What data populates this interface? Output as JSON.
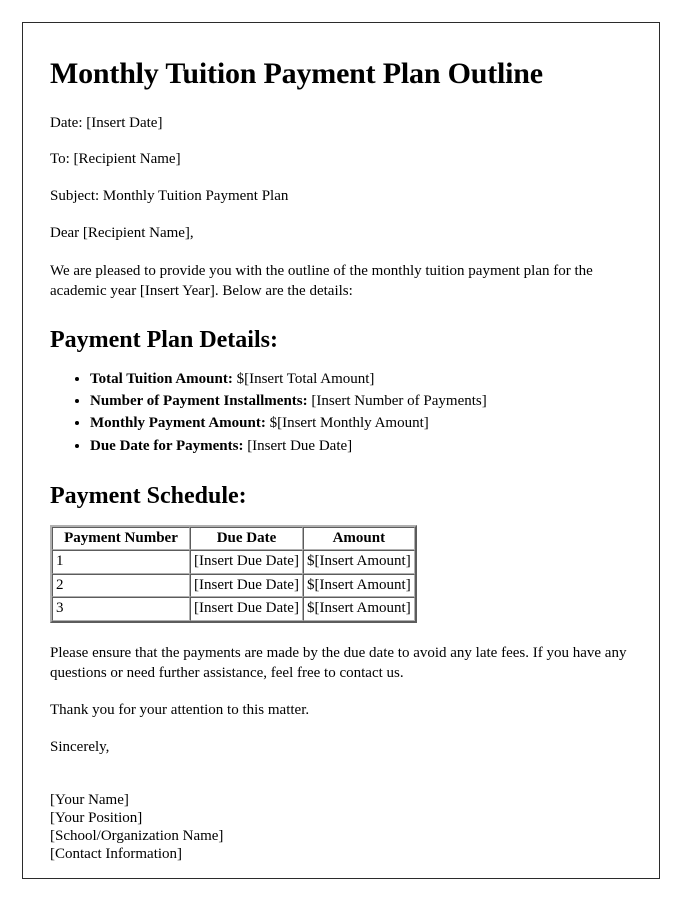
{
  "document": {
    "title": "Monthly Tuition Payment Plan Outline",
    "meta_lines": [
      "Date: [Insert Date]",
      "To: [Recipient Name]",
      "Subject: Monthly Tuition Payment Plan",
      "Dear [Recipient Name],"
    ],
    "intro_paragraph": "We are pleased to provide you with the outline of the monthly tuition payment plan for the academic year [Insert Year]. Below are the details:",
    "details": {
      "heading": "Payment Plan Details:",
      "items": [
        {
          "label": "Total Tuition Amount:",
          "value": "$[Insert Total Amount]"
        },
        {
          "label": "Number of Payment Installments:",
          "value": "[Insert Number of Payments]"
        },
        {
          "label": "Monthly Payment Amount:",
          "value": "$[Insert Monthly Amount]"
        },
        {
          "label": "Due Date for Payments:",
          "value": "[Insert Due Date]"
        }
      ]
    },
    "schedule": {
      "heading": "Payment Schedule:",
      "columns": [
        "Payment Number",
        "Due Date",
        "Amount"
      ],
      "rows": [
        [
          "1",
          "[Insert Due Date]",
          "$[Insert Amount]"
        ],
        [
          "2",
          "[Insert Due Date]",
          "$[Insert Amount]"
        ],
        [
          "3",
          "[Insert Due Date]",
          "$[Insert Amount]"
        ]
      ]
    },
    "closing_paragraphs": [
      "Please ensure that the payments are made by the due date to avoid any late fees. If you have any questions or need further assistance, feel free to contact us.",
      "Thank you for your attention to this matter.",
      "Sincerely,"
    ],
    "signature_lines": [
      "[Your Name]",
      "[Your Position]",
      "[School/Organization Name]",
      "[Contact Information]"
    ]
  }
}
